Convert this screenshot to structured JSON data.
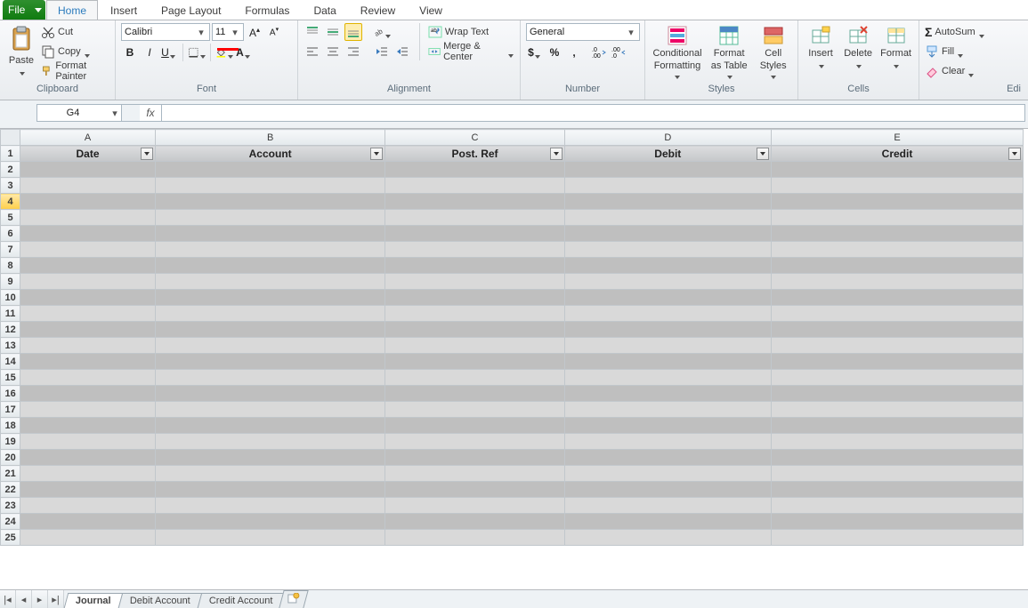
{
  "menu": {
    "file_label": "File",
    "tabs": [
      "Home",
      "Insert",
      "Page Layout",
      "Formulas",
      "Data",
      "Review",
      "View"
    ],
    "active_index": 0
  },
  "ribbon": {
    "clipboard": {
      "title": "Clipboard",
      "paste_label": "Paste",
      "cut_label": "Cut",
      "copy_label": "Copy",
      "format_painter_label": "Format Painter"
    },
    "font": {
      "title": "Font",
      "name": "Calibri",
      "size": "11"
    },
    "alignment": {
      "title": "Alignment",
      "wrap_label": "Wrap Text",
      "merge_label": "Merge & Center"
    },
    "number": {
      "title": "Number",
      "format": "General"
    },
    "styles": {
      "title": "Styles",
      "cond_format_l1": "Conditional",
      "cond_format_l2": "Formatting",
      "format_table_l1": "Format",
      "format_table_l2": "as Table",
      "cell_styles_l1": "Cell",
      "cell_styles_l2": "Styles"
    },
    "cells": {
      "title": "Cells",
      "insert_label": "Insert",
      "delete_label": "Delete",
      "format_label": "Format"
    },
    "editing": {
      "title": "Edi",
      "autosum_label": "AutoSum",
      "fill_label": "Fill",
      "clear_label": "Clear"
    }
  },
  "formulaBar": {
    "cell_ref": "G4",
    "fx_label": "fx",
    "formula_value": ""
  },
  "columns": [
    "A",
    "B",
    "C",
    "D",
    "E"
  ],
  "headers": [
    "Date",
    "Account",
    "Post. Ref",
    "Debit",
    "Credit"
  ],
  "rows": [
    1,
    2,
    3,
    4,
    5,
    6,
    7,
    8,
    9,
    10,
    11,
    12,
    13,
    14,
    15,
    16,
    17,
    18,
    19,
    20,
    21,
    22,
    23,
    24,
    25
  ],
  "selected_row": 4,
  "sheetTabs": {
    "items": [
      "Journal",
      "Debit Account",
      "Credit Account"
    ],
    "active_index": 0
  }
}
